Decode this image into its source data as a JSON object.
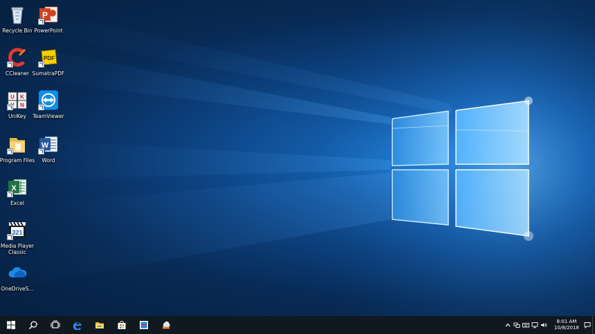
{
  "desktop": {
    "icons": [
      {
        "label": "Recycle Bin",
        "icon": "recycle-bin-icon"
      },
      {
        "label": "PowerPoint",
        "icon": "powerpoint-icon"
      },
      {
        "label": "CCleaner",
        "icon": "ccleaner-icon"
      },
      {
        "label": "SumatraPDF",
        "icon": "sumatrapdf-icon"
      },
      {
        "label": "UniKey",
        "icon": "unikey-icon"
      },
      {
        "label": "TeamViewer",
        "icon": "teamviewer-icon"
      },
      {
        "label": "Program Files",
        "icon": "folder-icon"
      },
      {
        "label": "Word",
        "icon": "word-icon"
      },
      {
        "label": "Excel",
        "icon": "excel-icon"
      },
      {
        "label": "Media Player Classic",
        "icon": "media-player-classic-icon"
      },
      {
        "label": "OneDriveS...",
        "icon": "onedrive-icon"
      }
    ],
    "icon_glyphs": {
      "powerpoint": "P",
      "word": "W",
      "excel": "X",
      "sumatrapdf": "PDF",
      "media_player_classic": "321",
      "unikey": [
        "U",
        "K",
        "V",
        "N"
      ]
    }
  },
  "taskbar": {
    "buttons": [
      {
        "icon": "windows-start-icon"
      },
      {
        "icon": "search-icon"
      },
      {
        "icon": "task-view-icon"
      },
      {
        "icon": "edge-browser-icon"
      },
      {
        "icon": "file-explorer-icon"
      },
      {
        "icon": "store-icon"
      },
      {
        "icon": "media-player-icon"
      },
      {
        "icon": "network-drive-icon"
      }
    ],
    "tray": {
      "icons": [
        "chevron-up-icon",
        "network-icon",
        "keyboard-icon",
        "monitor-icon",
        "volume-icon"
      ],
      "time": "8:01 AM",
      "date": "10/8/2018"
    }
  },
  "colors": {
    "taskbar": "#101820",
    "accent": "#1a8cff",
    "wallpaper_deep": "#06203f",
    "wallpaper_glow": "#6fc3ff"
  }
}
